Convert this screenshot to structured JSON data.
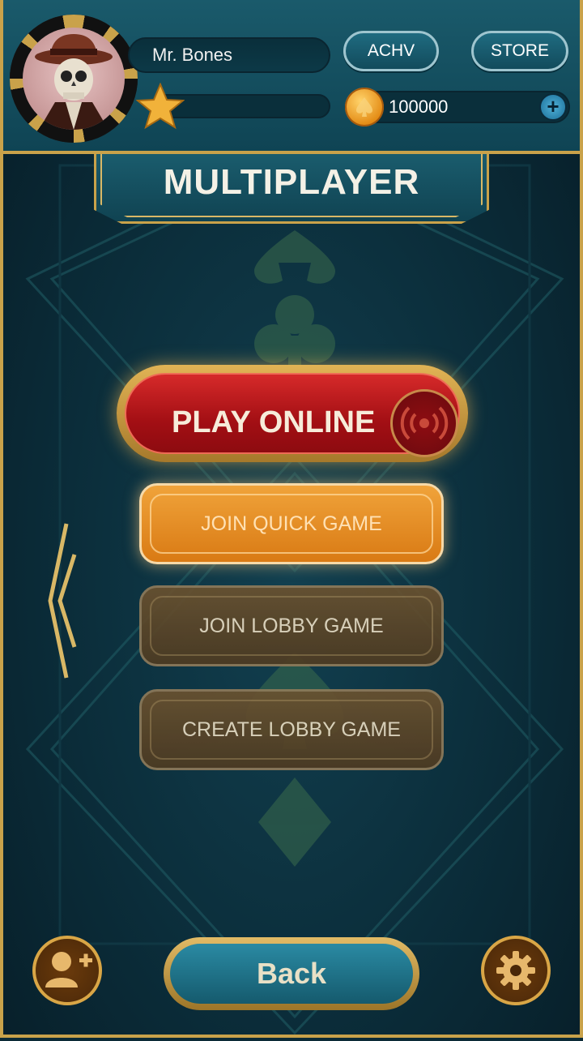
{
  "profile": {
    "name": "Mr. Bones",
    "coins": "100000"
  },
  "header": {
    "achv_label": "ACHV",
    "store_label": "STORE",
    "add_coins_symbol": "+"
  },
  "title": "MULTIPLAYER",
  "menu": {
    "play_online": "PLAY ONLINE",
    "join_quick": "JOIN QUICK GAME",
    "join_lobby": "JOIN LOBBY GAME",
    "create_lobby": "CREATE LOBBY GAME"
  },
  "footer": {
    "back_label": "Back"
  },
  "icons": {
    "avatar": "skeleton-detective-avatar",
    "star": "star-icon",
    "coin": "spade-coin-icon",
    "signal": "broadcast-icon",
    "add_friend": "add-user-icon",
    "settings": "gear-icon",
    "prev": "chevron-left-icon"
  },
  "colors": {
    "gold": "#c9a24a",
    "teal": "#124b5c",
    "red": "#c41f22",
    "orange": "#e88a22"
  }
}
